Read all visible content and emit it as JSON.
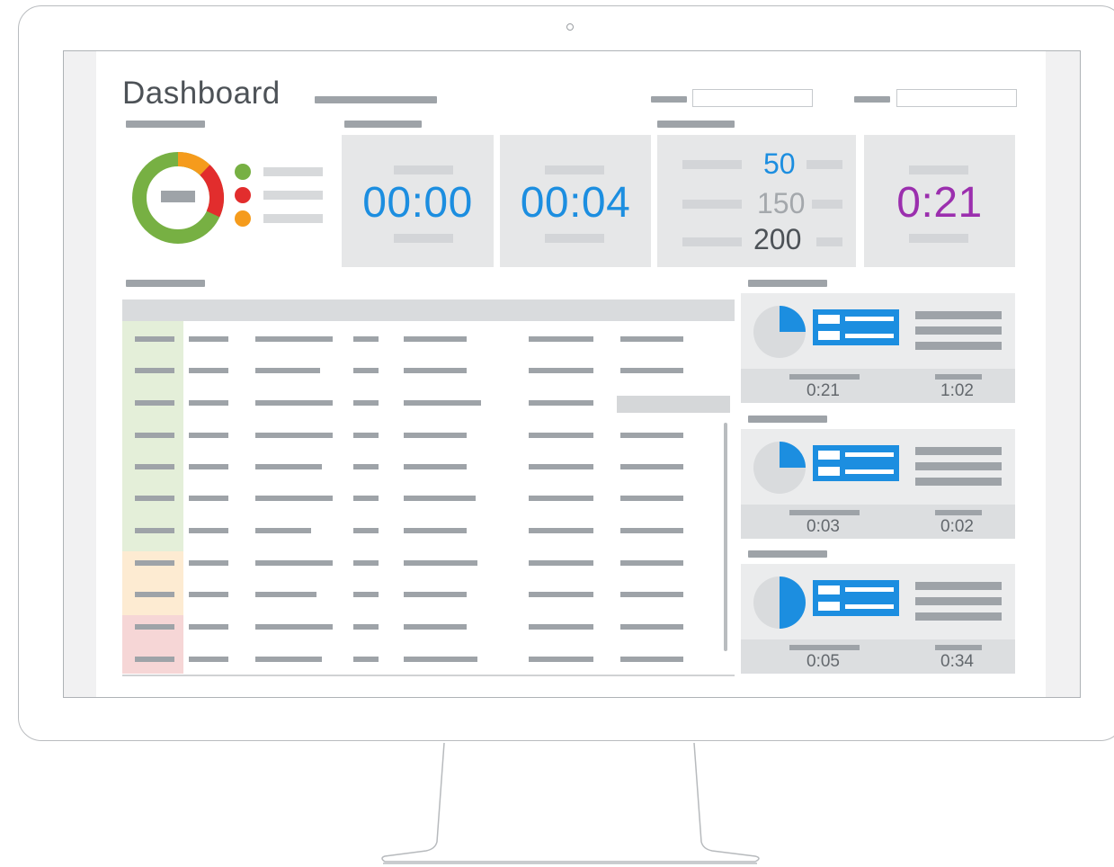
{
  "dashboard": {
    "title": "Dashboard"
  },
  "tiles": {
    "time1": "00:00",
    "time2": "00:04",
    "counts": [
      "50",
      "150",
      "200"
    ],
    "time3": "0:21"
  },
  "cards": [
    {
      "left_time": "0:21",
      "right_time": "1:02"
    },
    {
      "left_time": "0:03",
      "right_time": "0:02"
    },
    {
      "left_time": "0:05",
      "right_time": "0:34"
    }
  ],
  "colors": {
    "blue": "#1c8ee0",
    "purple": "#9b2fae",
    "green": "#77b043",
    "orange": "#f59b1c",
    "red": "#e22d2d"
  }
}
